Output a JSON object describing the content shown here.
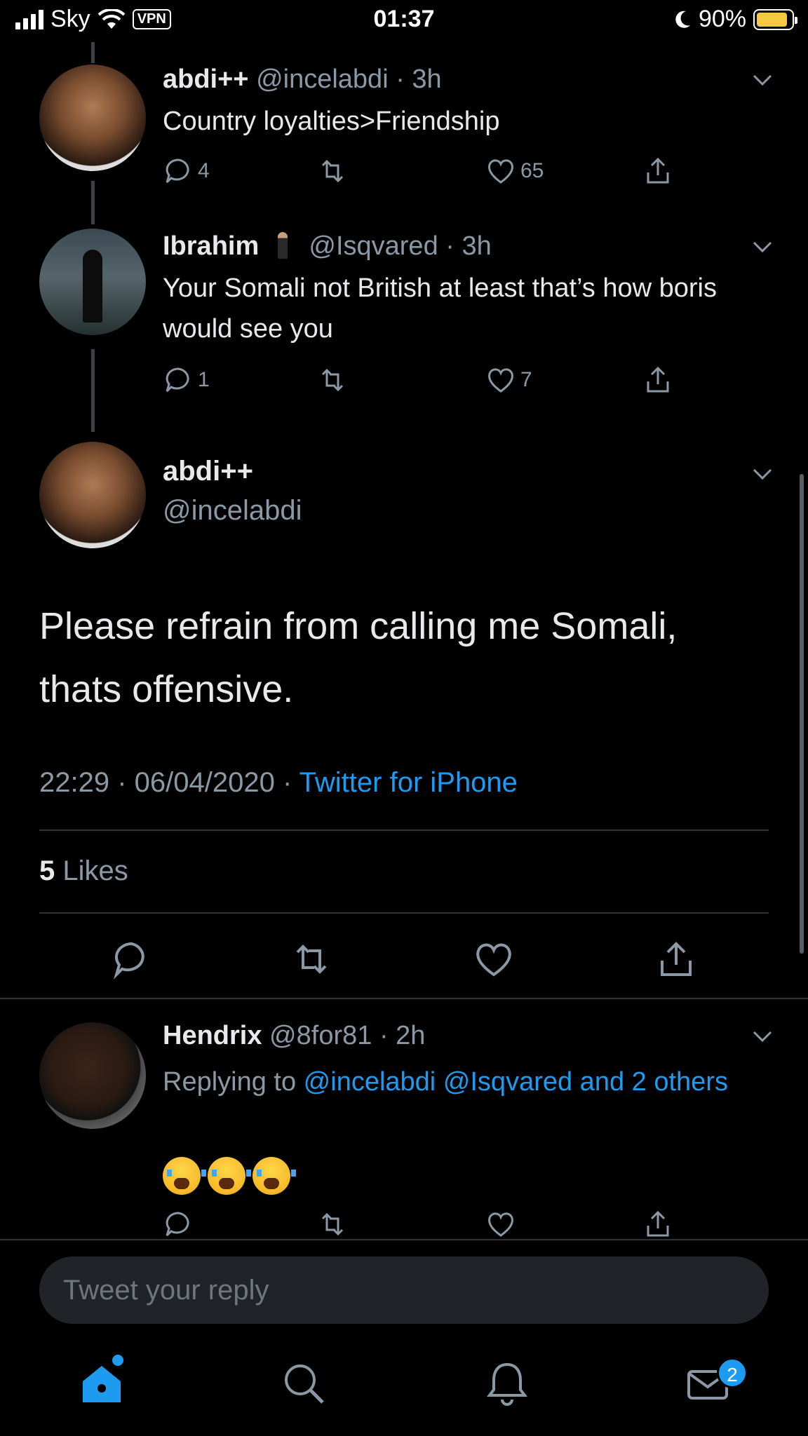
{
  "status_bar": {
    "carrier": "Sky",
    "vpn": "VPN",
    "time": "01:37",
    "battery": "90%",
    "battery_color": "#f5c941"
  },
  "tweets": [
    {
      "name": "abdi++",
      "handle": "@incelabdi",
      "time": "· 3h",
      "text": "Country loyalties>Friendship",
      "replies": "4",
      "likes": "65"
    },
    {
      "name": "Ibrahim",
      "handle": "@Isqvared",
      "time": "· 3h",
      "text": "Your Somali not British at least that’s how boris would see you",
      "replies": "1",
      "likes": "7"
    }
  ],
  "main_tweet": {
    "name": "abdi++",
    "handle": "@incelabdi",
    "text": "Please refrain from calling me Somali, thats offensive.",
    "timestamp": "22:29 · 06/04/2020 · ",
    "source": "Twitter for iPhone",
    "likes_count": "5",
    "likes_label": "Likes"
  },
  "reply": {
    "name": "Hendrix",
    "handle": "@8for81",
    "time": "· 2h",
    "replying_prefix": "Replying to ",
    "replying_targets": "@incelabdi @Isqvared and 2 others",
    "emoji": "crying-face x3"
  },
  "composer": {
    "placeholder": "Tweet your reply"
  },
  "tab_bar": {
    "items": [
      "home-icon",
      "search-icon",
      "notifications-icon",
      "messages-icon"
    ],
    "messages_badge": "2",
    "accent": "#1d9bf0"
  }
}
